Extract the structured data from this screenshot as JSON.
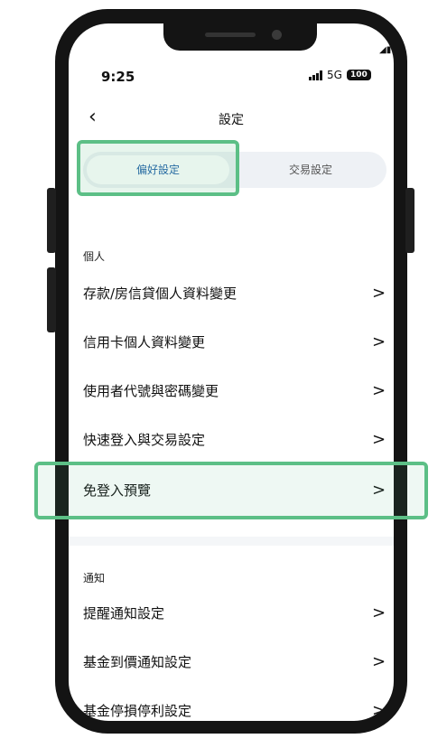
{
  "status": {
    "time": "9:25",
    "network": "5G",
    "battery": "100"
  },
  "header": {
    "back_icon": "chevron-left-icon",
    "title": "設定"
  },
  "tabs": [
    {
      "label": "偏好設定",
      "selected": true
    },
    {
      "label": "交易設定",
      "selected": false
    }
  ],
  "sections": {
    "personal": {
      "title": "個人",
      "items": [
        {
          "label": "存款/房信貸個人資料變更"
        },
        {
          "label": "信用卡個人資料變更"
        },
        {
          "label": "使用者代號與密碼變更"
        },
        {
          "label": "快速登入與交易設定"
        },
        {
          "label": "免登入預覽"
        }
      ]
    },
    "notify": {
      "title": "通知",
      "items": [
        {
          "label": "提醒通知設定"
        },
        {
          "label": "基金到價通知設定"
        },
        {
          "label": "基金停損停利設定"
        }
      ]
    }
  },
  "chevron": ">",
  "colors": {
    "accent": "#1f5fa8",
    "highlight": "#5cbf86",
    "tab_bg": "#eef1f5"
  }
}
